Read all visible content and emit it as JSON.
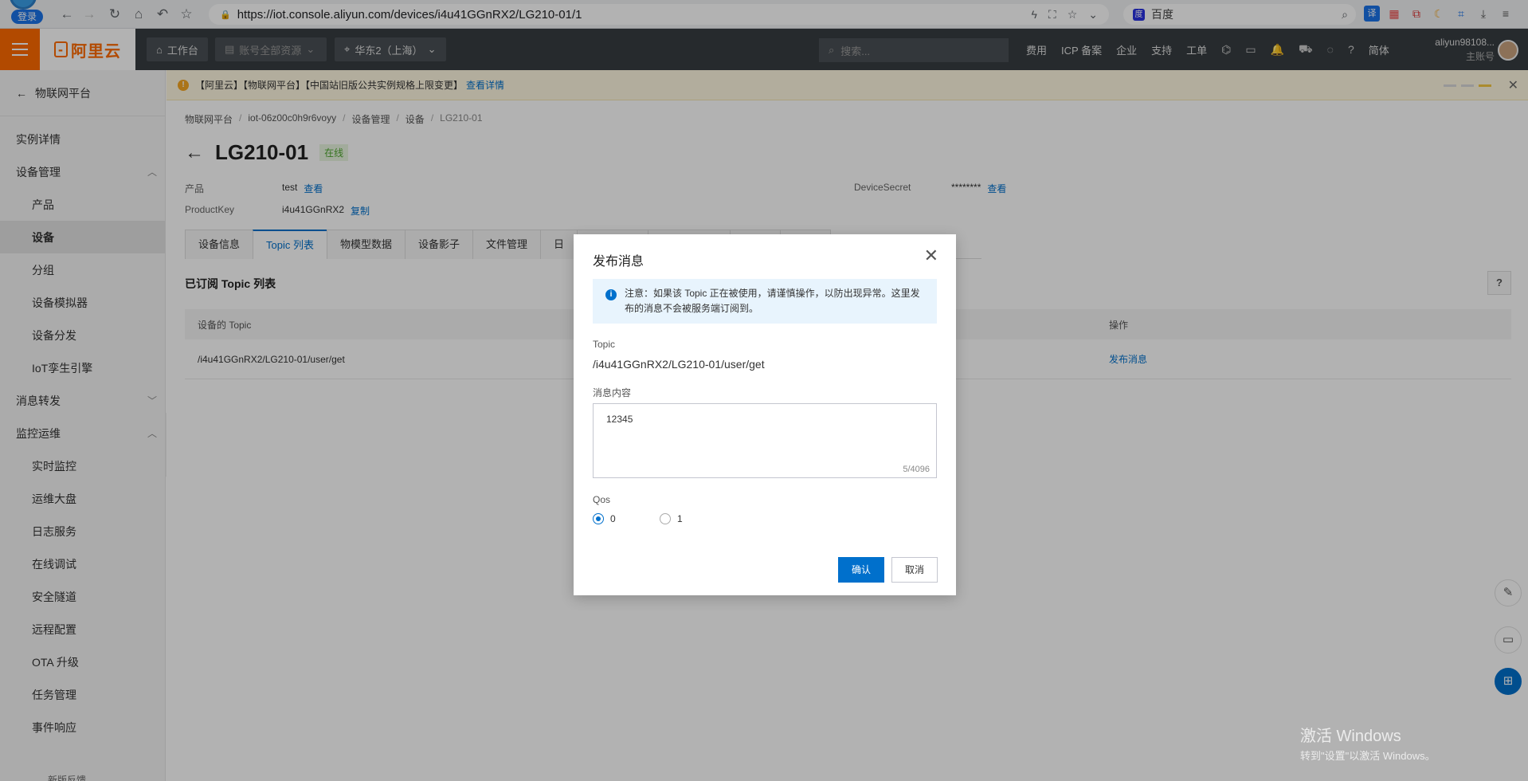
{
  "browser": {
    "login_label": "登录",
    "url": "https://iot.console.aliyun.com/devices/i4u41GGnRX2/LG210-01/1",
    "search_engine": "百度"
  },
  "topnav": {
    "brand": "阿里云",
    "workbench": "工作台",
    "resources": "账号全部资源",
    "region": "华东2（上海）",
    "search_placeholder": "搜索...",
    "links": [
      "费用",
      "ICP 备案",
      "企业",
      "支持",
      "工单",
      "简体"
    ],
    "account_name": "aliyun98108...",
    "account_type": "主账号"
  },
  "sidebar": {
    "back_label": "物联网平台",
    "items": [
      {
        "label": "实例详情",
        "level": 1
      },
      {
        "label": "设备管理",
        "level": 1,
        "chevron": "up"
      },
      {
        "label": "产品",
        "level": 2
      },
      {
        "label": "设备",
        "level": 2,
        "active": true
      },
      {
        "label": "分组",
        "level": 2
      },
      {
        "label": "设备模拟器",
        "level": 2
      },
      {
        "label": "设备分发",
        "level": 2
      },
      {
        "label": "IoT孪生引擎",
        "level": 2
      },
      {
        "label": "消息转发",
        "level": 1,
        "chevron": "down"
      },
      {
        "label": "监控运维",
        "level": 1,
        "chevron": "up"
      },
      {
        "label": "实时监控",
        "level": 2
      },
      {
        "label": "运维大盘",
        "level": 2
      },
      {
        "label": "日志服务",
        "level": 2
      },
      {
        "label": "在线调试",
        "level": 2
      },
      {
        "label": "安全隧道",
        "level": 2
      },
      {
        "label": "远程配置",
        "level": 2
      },
      {
        "label": "OTA 升级",
        "level": 2
      },
      {
        "label": "任务管理",
        "level": 2
      },
      {
        "label": "事件响应",
        "level": 2
      }
    ],
    "bottom": "新版反馈"
  },
  "notice": {
    "text": "【阿里云】【物联网平台】【中国站旧版公共实例规格上限变更】",
    "link": "查看详情"
  },
  "breadcrumb": [
    "物联网平台",
    "iot-06z00c0h9r6voyy",
    "设备管理",
    "设备",
    "LG210-01"
  ],
  "device": {
    "name": "LG210-01",
    "status": "在线",
    "product_label": "产品",
    "product_value": "test",
    "product_action": "查看",
    "productkey_label": "ProductKey",
    "productkey_value": "i4u41GGnRX2",
    "productkey_action": "复制",
    "secret_label": "DeviceSecret",
    "secret_value": "********",
    "secret_action": "查看"
  },
  "tabs": [
    "设备信息",
    "Topic 列表",
    "物模型数据",
    "设备影子",
    "文件管理",
    "日",
    "",
    "",
    "",
    ""
  ],
  "section_title": "已订阅 Topic 列表",
  "table": {
    "headers": [
      "设备的 Topic",
      "操作"
    ],
    "rows": [
      {
        "topic": "/i4u41GGnRX2/LG210-01/user/get",
        "action": "发布消息"
      }
    ]
  },
  "modal": {
    "title": "发布消息",
    "alert_line1": "注意：如果该 Topic 正在被使用，请谨慎操作，以防出现异常。这里发",
    "alert_line2": "布的消息不会被服务端订阅到。",
    "topic_label": "Topic",
    "topic_value": "/i4u41GGnRX2/LG210-01/user/get",
    "content_label": "消息内容",
    "content_value": "12345",
    "content_count": "5/4096",
    "qos_label": "Qos",
    "qos_options": [
      "0",
      "1"
    ],
    "qos_selected": "0",
    "confirm_label": "确认",
    "cancel_label": "取消"
  },
  "watermark": {
    "line1": "激活 Windows",
    "line2": "转到\"设置\"以激活 Windows。"
  },
  "colors": {
    "brand_orange": "#ff6a00",
    "primary_blue": "#0070cc",
    "online_green": "#4ea72e"
  }
}
